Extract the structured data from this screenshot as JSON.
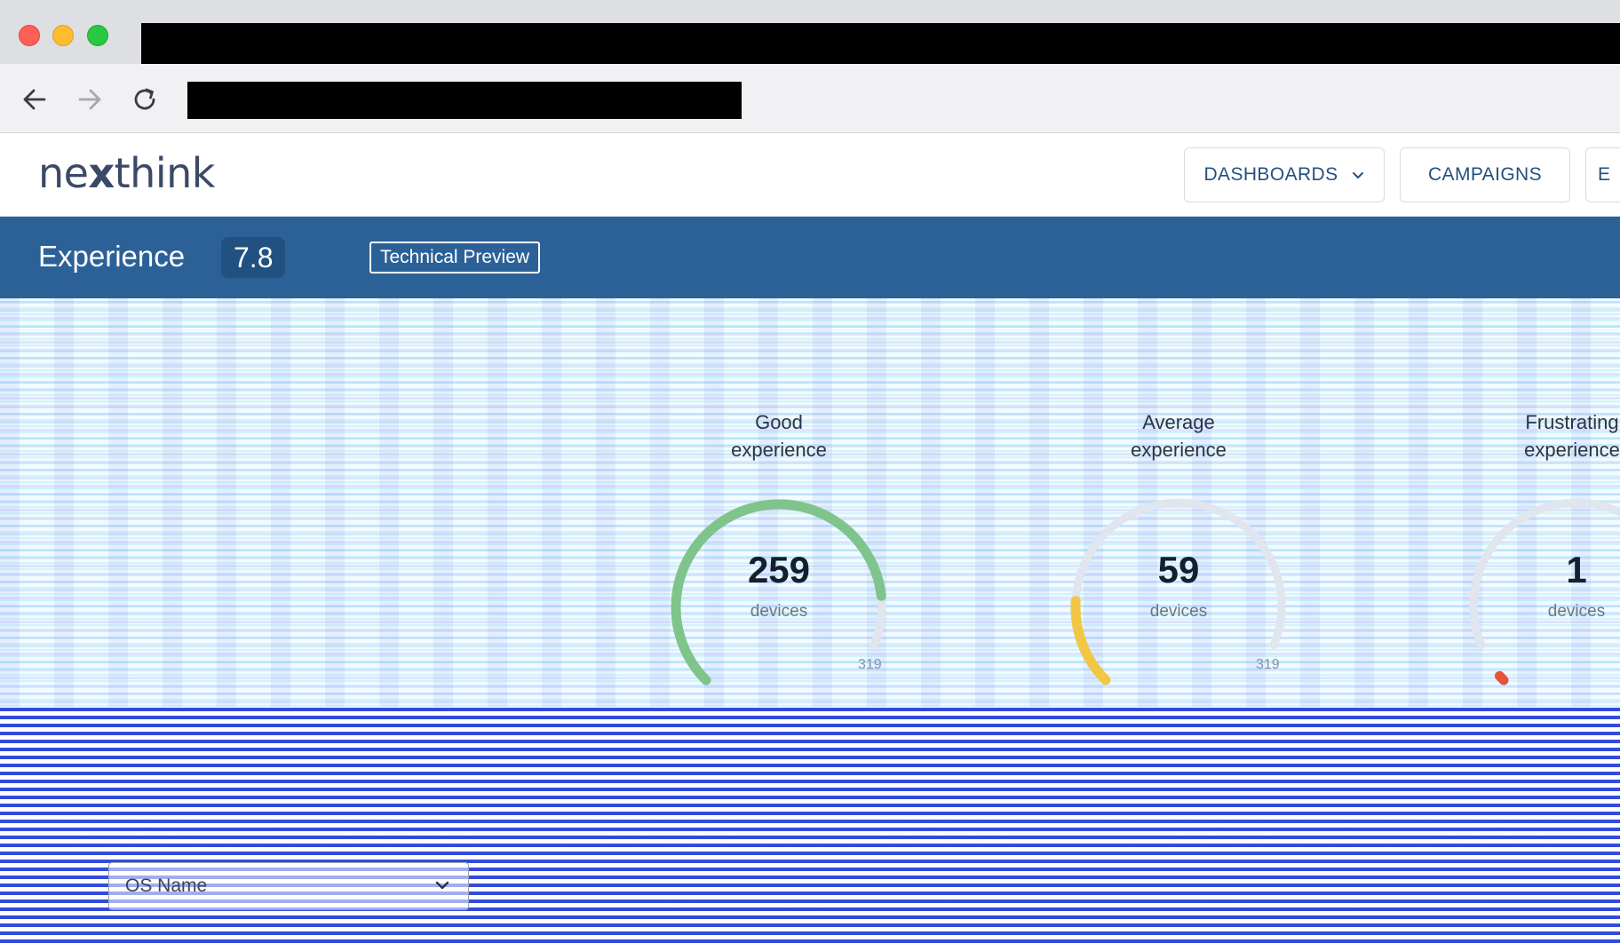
{
  "app": {
    "logo": "nexthink"
  },
  "nav": {
    "items": [
      {
        "label": "DASHBOARDS"
      },
      {
        "label": "CAMPAIGNS"
      },
      {
        "label": "E"
      }
    ]
  },
  "header": {
    "title": "Experience",
    "score": "7.8",
    "badge": "Technical Preview"
  },
  "gauges": [
    {
      "title_line1": "Good",
      "title_line2": "experience",
      "count": "259",
      "unit": "devices",
      "max": "319",
      "level": 0.81,
      "color": "#7ec48b"
    },
    {
      "title_line1": "Average",
      "title_line2": "experience",
      "count": "59",
      "unit": "devices",
      "max": "319",
      "level": 0.18,
      "color": "#f2c744"
    },
    {
      "title_line1": "Frustrating",
      "title_line2": "experience",
      "count": "1",
      "unit": "devices",
      "level": 0.01,
      "color": "#e5533d"
    }
  ],
  "filters": {
    "os_name_placeholder": "OS Name"
  }
}
